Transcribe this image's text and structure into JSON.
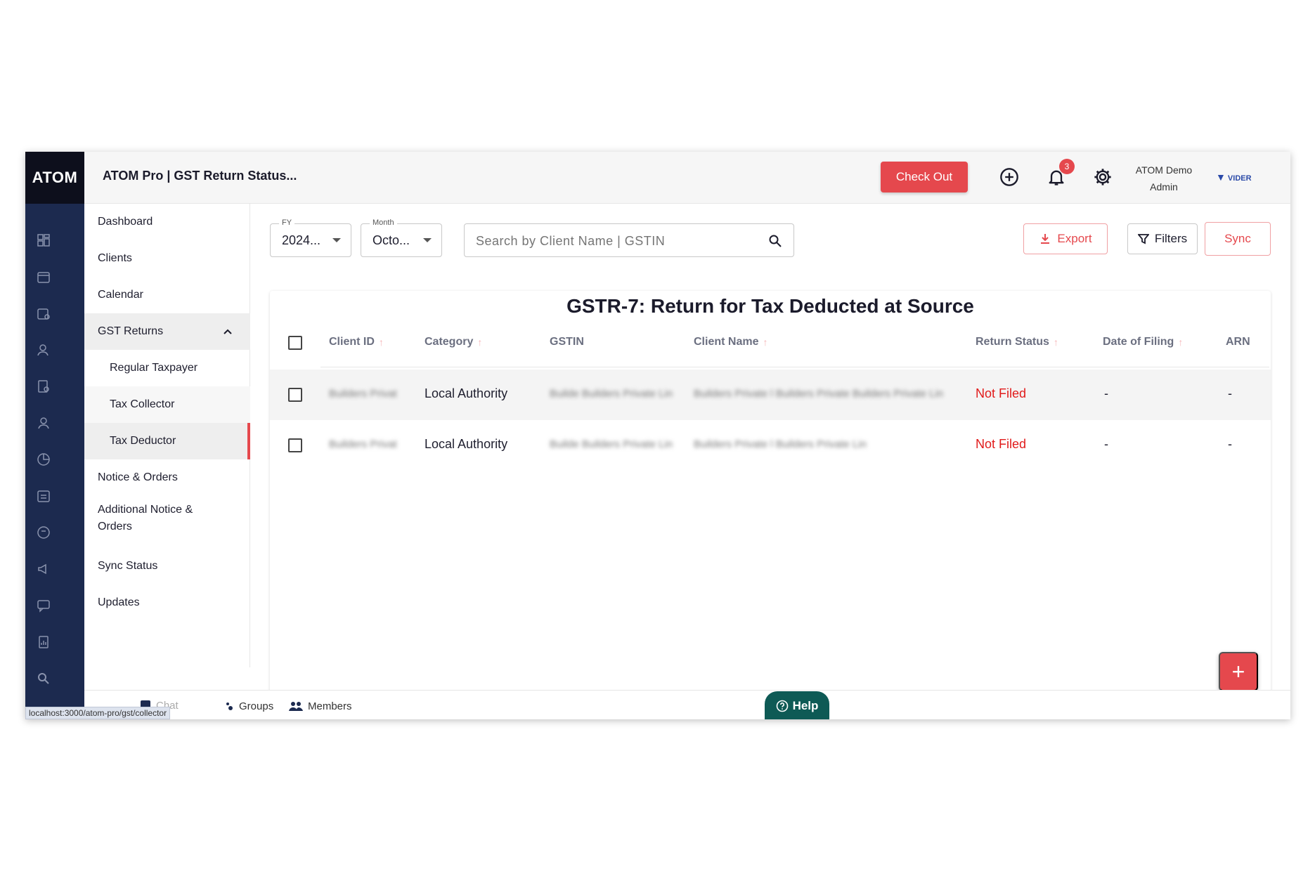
{
  "header": {
    "logo": "ATOM",
    "title": "ATOM Pro | GST Return Status...",
    "checkout_label": "Check Out",
    "notification_count": "3",
    "user_name": "ATOM Demo",
    "user_role": "Admin",
    "brand": "VIDER"
  },
  "sidebar": {
    "items": [
      {
        "label": "Dashboard"
      },
      {
        "label": "Clients"
      },
      {
        "label": "Calendar"
      },
      {
        "label": "GST Returns"
      },
      {
        "label": "Regular Taxpayer"
      },
      {
        "label": "Tax Collector"
      },
      {
        "label": "Tax Deductor"
      },
      {
        "label": "Notice & Orders"
      },
      {
        "label": "Additional Notice & Orders"
      },
      {
        "label": "Sync Status"
      },
      {
        "label": "Updates"
      }
    ]
  },
  "toolbar": {
    "fy_label": "FY",
    "fy_value": "2024...",
    "month_label": "Month",
    "month_value": "Octo...",
    "search_placeholder": "Search by Client Name | GSTIN",
    "export_label": "Export",
    "filters_label": "Filters",
    "sync_label": "Sync"
  },
  "table": {
    "title": "GSTR-7: Return for Tax Deducted at Source",
    "columns": [
      "Client ID",
      "Category",
      "GSTIN",
      "Client Name",
      "Return Status",
      "Date of Filing",
      "ARN"
    ],
    "rows": [
      {
        "client_id": "Builders Privat",
        "category": "Local Authority",
        "gstin": "Builde Builders Private Lin",
        "client_name": "Builders Private l Builders Private Builders Private Lin",
        "status": "Not Filed",
        "date": "-",
        "arn": "-"
      },
      {
        "client_id": "Builders Privat",
        "category": "Local Authority",
        "gstin": "Builde Builders Private Lin",
        "client_name": "Builders Private l Builders Private Lin",
        "status": "Not Filed",
        "date": "-",
        "arn": "-"
      }
    ]
  },
  "fab_label": "+",
  "bottom": {
    "chat_label": "Chat",
    "groups_label": "Groups",
    "members_label": "Members",
    "help_label": "Help",
    "status_url": "localhost:3000/atom-pro/gst/collector"
  },
  "colors": {
    "accent": "#e5484d",
    "rail": "#1c2a4f",
    "help": "#0e5a55",
    "not_filed": "#e11b1b"
  }
}
